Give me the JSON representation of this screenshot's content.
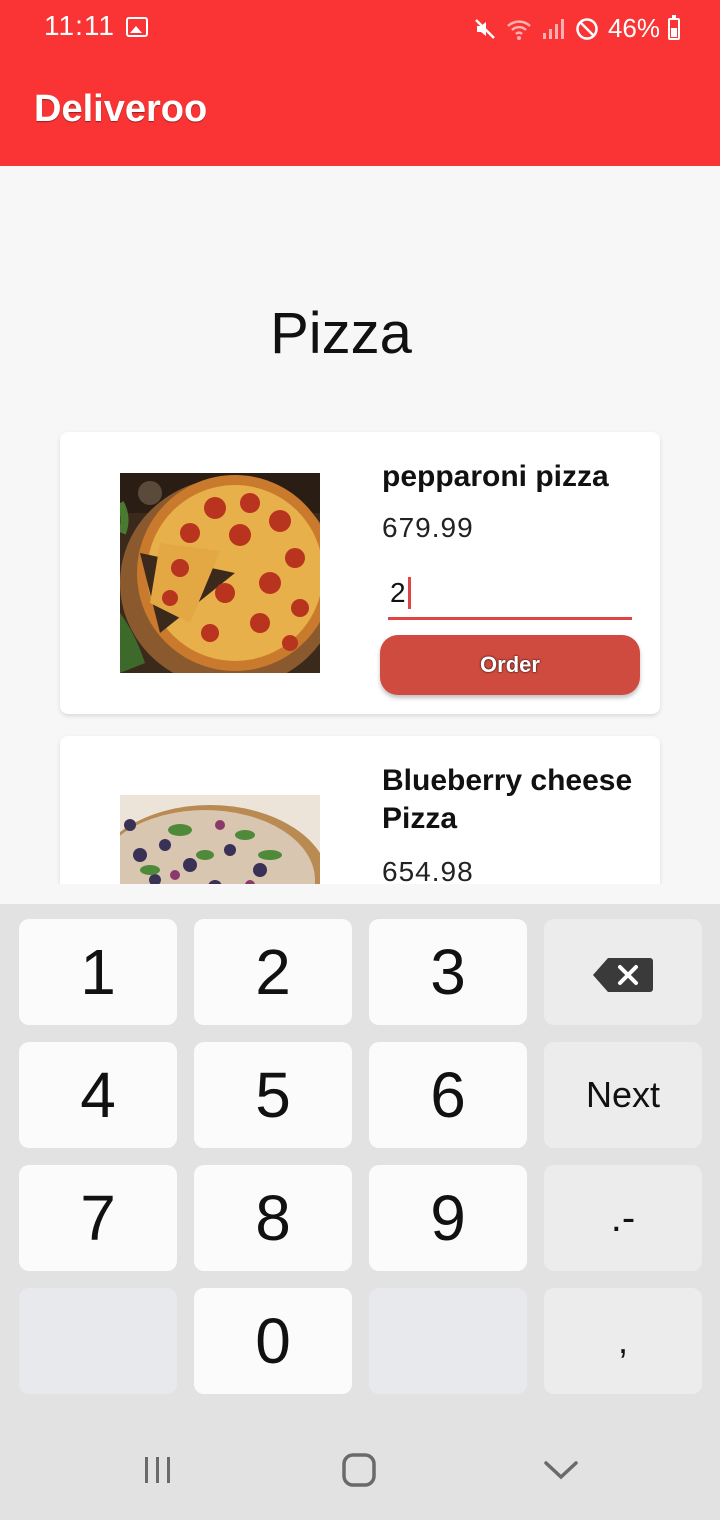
{
  "status_bar": {
    "time": "11:11",
    "battery_text": "46%",
    "battery_level": 0.46
  },
  "app": {
    "title": "Deliveroo",
    "header_color": "#fa3434"
  },
  "page": {
    "title": "Pizza"
  },
  "products": [
    {
      "name": "pepparoni pizza",
      "price": "679.99",
      "quantity": "2",
      "order_label": "Order"
    },
    {
      "name": "Blueberry cheese Pizza",
      "price": "654.98"
    }
  ],
  "keyboard": {
    "keys": [
      "1",
      "2",
      "3",
      "4",
      "5",
      "6",
      "Next",
      "7",
      "8",
      "9",
      ".-",
      "0",
      ","
    ],
    "next_label": "Next"
  },
  "colors": {
    "accent": "#fa3434",
    "button": "#cf4a3f",
    "underline": "#e04444"
  }
}
